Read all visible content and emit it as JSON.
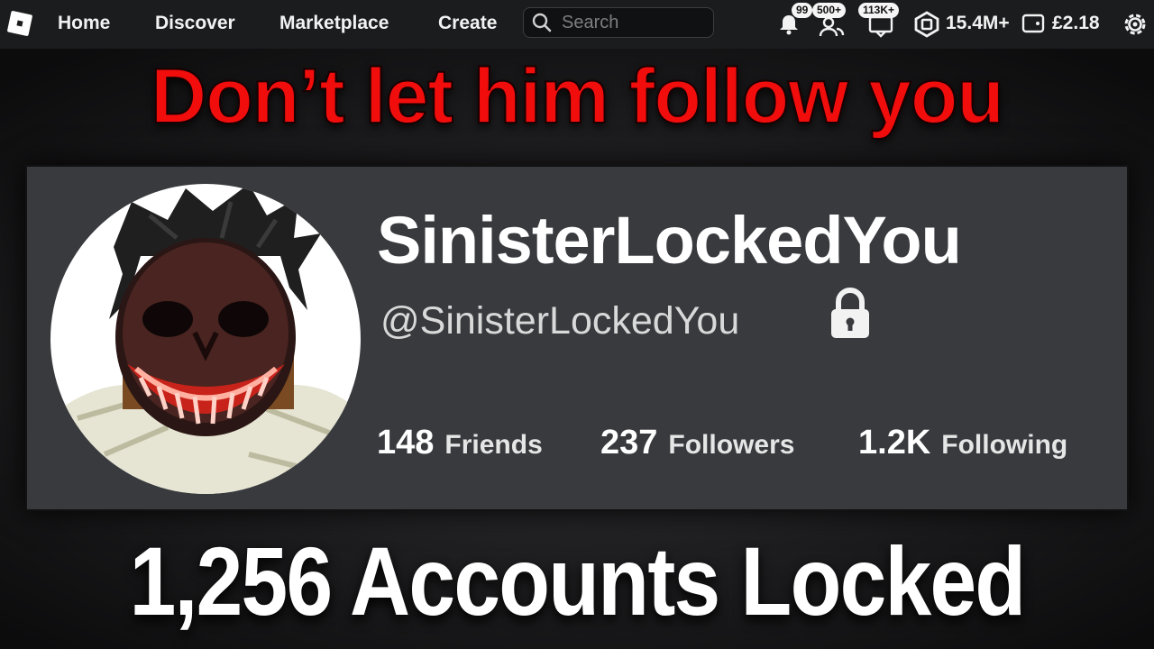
{
  "nav": {
    "links": [
      "Home",
      "Discover",
      "Marketplace",
      "Create"
    ],
    "search_placeholder": "Search",
    "notifications_badge": "99",
    "friends_badge": "500+",
    "messages_badge": "113K+",
    "robux": "15.4M+",
    "balance": "£2.18",
    "icons": [
      "roblox-logo-icon",
      "search-icon",
      "bell-icon",
      "friends-icon",
      "chat-icon",
      "robux-icon",
      "wallet-icon",
      "gear-icon"
    ]
  },
  "headline": "Don’t let him follow you",
  "profile": {
    "display_name": "SinisterLockedYou",
    "username": "@SinisterLockedYou",
    "stats": [
      {
        "value": "148",
        "label": "Friends"
      },
      {
        "value": "237",
        "label": "Followers"
      },
      {
        "value": "1.2K",
        "label": "Following"
      }
    ]
  },
  "caption": "1,256 Accounts Locked",
  "colors": {
    "headline": "#f20d0d",
    "card": "#383a3e",
    "navbar": "#1b1c1e"
  }
}
